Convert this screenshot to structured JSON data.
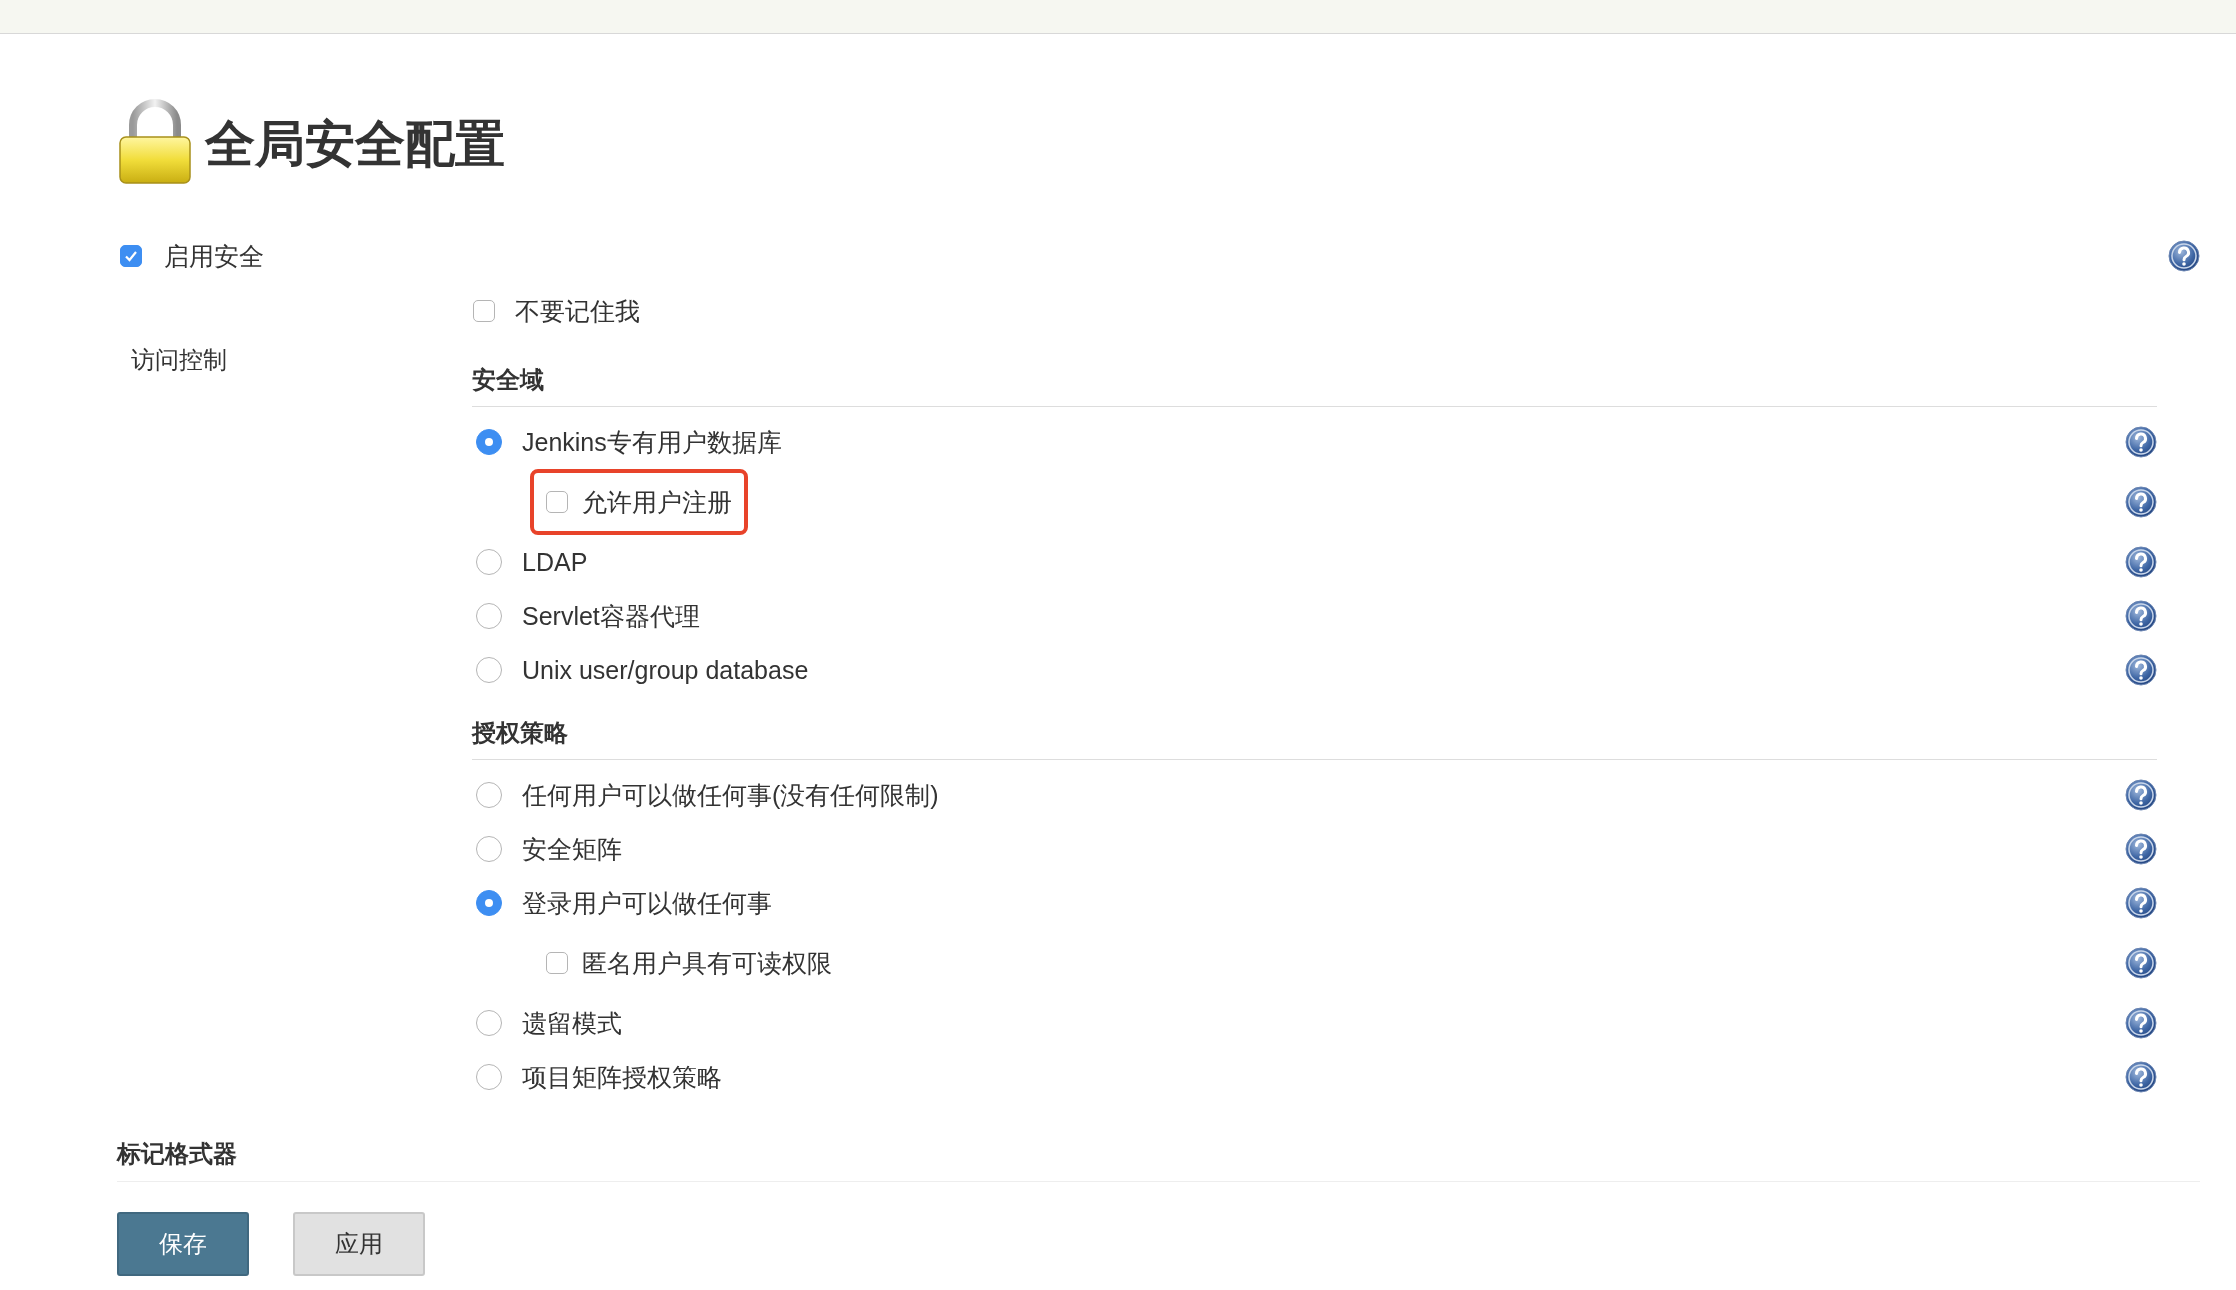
{
  "header": {
    "title": "全局安全配置"
  },
  "enable_security": {
    "label": "启用安全",
    "checked": true,
    "help": true
  },
  "access_control": {
    "label": "访问控制",
    "options": [
      {
        "kind": "checkbox",
        "label": "不要记住我",
        "checked": false,
        "help": false
      }
    ],
    "groups": [
      {
        "title": "安全域",
        "options": [
          {
            "kind": "radio",
            "label": "Jenkins专有用户数据库",
            "selected": true,
            "help": true,
            "children": [
              {
                "kind": "checkbox",
                "label": "允许用户注册",
                "checked": false,
                "help": true,
                "highlighted": true
              }
            ]
          },
          {
            "kind": "radio",
            "label": "LDAP",
            "selected": false,
            "help": true
          },
          {
            "kind": "radio",
            "label": "Servlet容器代理",
            "selected": false,
            "help": true
          },
          {
            "kind": "radio",
            "label": "Unix user/group database",
            "selected": false,
            "help": true
          }
        ]
      },
      {
        "title": "授权策略",
        "options": [
          {
            "kind": "radio",
            "label": "任何用户可以做任何事(没有任何限制)",
            "selected": false,
            "help": true
          },
          {
            "kind": "radio",
            "label": "安全矩阵",
            "selected": false,
            "help": true
          },
          {
            "kind": "radio",
            "label": "登录用户可以做任何事",
            "selected": true,
            "help": true,
            "children": [
              {
                "kind": "checkbox",
                "label": "匿名用户具有可读权限",
                "checked": false,
                "help": true,
                "highlighted": false
              }
            ]
          },
          {
            "kind": "radio",
            "label": "遗留模式",
            "selected": false,
            "help": true
          },
          {
            "kind": "radio",
            "label": "项目矩阵授权策略",
            "selected": false,
            "help": true
          }
        ]
      }
    ]
  },
  "markup_formatter": {
    "title": "标记格式器"
  },
  "buttons": [
    {
      "label": "保存",
      "kind": "primary"
    },
    {
      "label": "应用",
      "kind": "secondary"
    }
  ]
}
